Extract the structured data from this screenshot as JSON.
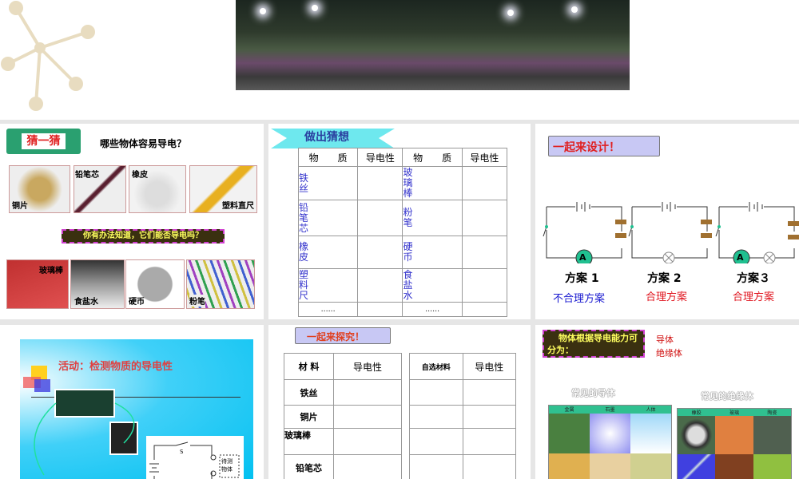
{
  "slide2": {
    "tag": "猜一猜",
    "question": "哪些物体容易导电？",
    "items_top": [
      "铜片",
      "铅笔芯",
      "橡皮",
      "塑料直尺"
    ],
    "prompt": "你有办法知道，它们能否导电吗？",
    "items_bottom": [
      "玻璃棒",
      "食盐水",
      "硬币",
      "粉笔"
    ]
  },
  "slide3": {
    "title": "做出猜想",
    "headers": [
      "物　　质",
      "导电性",
      "物　　质",
      "导电性"
    ],
    "left": [
      "铁丝",
      "铅笔芯",
      "橡皮",
      "塑料尺",
      "……"
    ],
    "right": [
      "玻璃棒",
      "粉笔",
      "硬币",
      "食盐水",
      "……"
    ]
  },
  "slide4": {
    "title": "一起来设计！",
    "plans": [
      {
        "name": "方案 1",
        "verdict": "不合理方案",
        "color": "#1a1ad0"
      },
      {
        "name": "方案 2",
        "verdict": "合理方案",
        "color": "#e0141e"
      },
      {
        "name": "方案３",
        "verdict": "合理方案",
        "color": "#e0141e"
      }
    ],
    "meter": "A"
  },
  "slide5": {
    "title": "活动：检测物质的导电性",
    "switch": "S",
    "object": "待测物体"
  },
  "slide6": {
    "title": "一起来探究！",
    "headers": [
      "材 料",
      "导电性",
      "自选材料",
      "导电性"
    ],
    "rows": [
      "铁丝",
      "铜片",
      "玻璃棒",
      "铅笔芯"
    ]
  },
  "slide7": {
    "box": "物体根据导电能力可分为：",
    "cat1": "导体",
    "cat2": "绝缘体",
    "cond_title": "常见的导体",
    "cond_cols": [
      "金属",
      "石墨",
      "人体"
    ],
    "ins_title": "常见的绝缘体",
    "ins_cols": [
      "橡胶",
      "玻璃",
      "陶瓷"
    ]
  }
}
